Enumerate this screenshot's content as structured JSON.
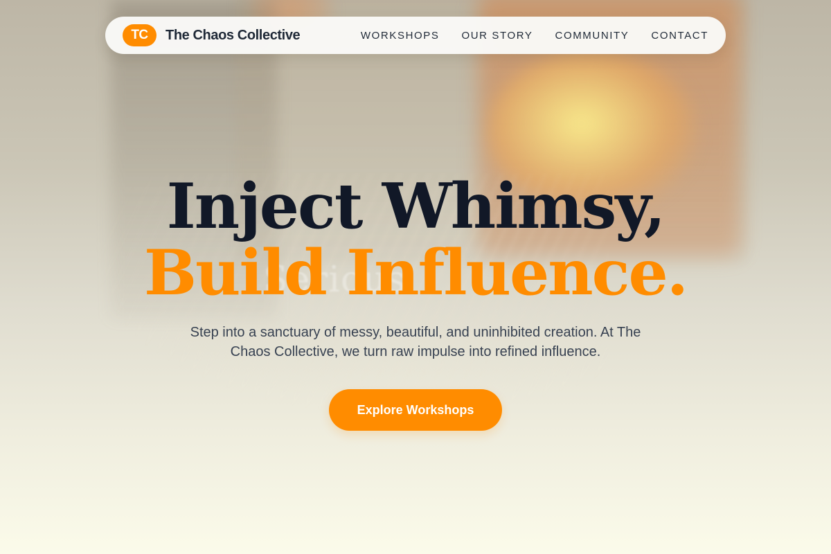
{
  "brand": {
    "badge": "TC",
    "name": "The Chaos Collective",
    "accent_color": "#FF8C00"
  },
  "nav": {
    "items": [
      {
        "label": "WORKSHOPS"
      },
      {
        "label": "OUR STORY"
      },
      {
        "label": "COMMUNITY"
      },
      {
        "label": "CONTACT"
      }
    ]
  },
  "hero": {
    "headline_line1": "Inject Whimsy,",
    "headline_line2": "Build Influence.",
    "description": "Step into a sanctuary of messy, beautiful, and uninhibited creation. At The Chaos Collective, we turn raw impulse into refined influence.",
    "cta_label": "Explore Workshops",
    "background_watermark": "Serious"
  },
  "colors": {
    "headline_dark": "#111827",
    "headline_accent": "#FF8C00",
    "body_text": "#374151",
    "nav_background": "#FAFAF8"
  }
}
